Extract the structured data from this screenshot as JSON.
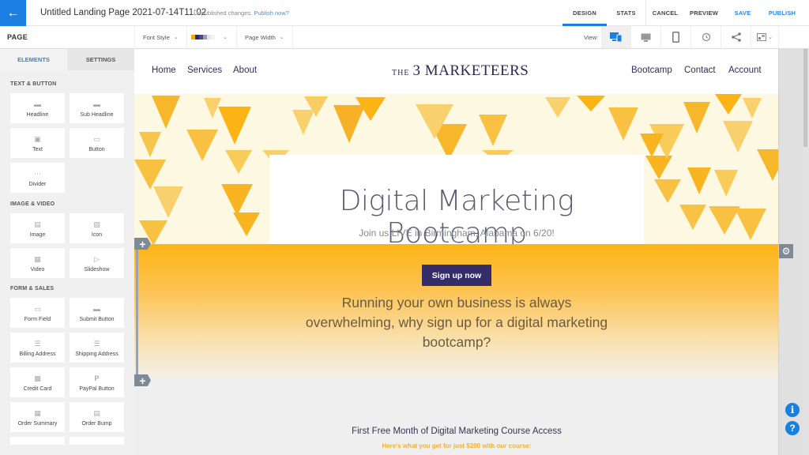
{
  "topbar": {
    "back_icon": "arrow-left-icon",
    "title": "Untitled Landing Page 2021-07-14T11:02",
    "unpublished_text": "Unpublished changes.",
    "publish_link": "Publish now?",
    "tabs": {
      "design": "DESIGN",
      "stats": "STATS",
      "cancel": "CANCEL",
      "preview": "PREVIEW",
      "save": "SAVE",
      "publish": "PUBLISH"
    },
    "accent_color": "#1a7fe0"
  },
  "toolbar": {
    "page_label": "PAGE",
    "font_style": "Font Style",
    "palette_colors": [
      "#f6a800",
      "#2d2a6a",
      "#4b4a7e",
      "#9c9cb0",
      "#e4e4ea",
      "#f4f4f6"
    ],
    "page_width": "Page Width",
    "view_label": "View:",
    "view_buttons": [
      "responsive-view-icon",
      "desktop-icon",
      "mobile-icon",
      "history-icon",
      "share-icon",
      "image-settings-icon"
    ]
  },
  "sidebar": {
    "tabs": {
      "elements": "ELEMENTS",
      "settings": "SETTINGS"
    },
    "sections": [
      {
        "title": "TEXT & BUTTON",
        "items": [
          "Headline",
          "Sub Headline",
          "Text",
          "Button",
          "Divider"
        ]
      },
      {
        "title": "IMAGE & VIDEO",
        "items": [
          "Image",
          "Icon",
          "Video",
          "Slideshow"
        ]
      },
      {
        "title": "FORM & SALES",
        "items": [
          "Form Field",
          "Submit Button",
          "Billing Address",
          "Shipping Address",
          "Credit Card",
          "PayPal Button",
          "Order Summary",
          "Order Bump"
        ]
      }
    ]
  },
  "page": {
    "nav_left": [
      "Home",
      "Services",
      "About"
    ],
    "logo_small": "THE",
    "logo_main": "3 MARKETEERS",
    "nav_right": [
      "Bootcamp",
      "Contact",
      "Account"
    ],
    "hero_title": "Digital Marketing Bootcamp",
    "hero_subtitle": "Join us LIVE in Birmingham, Alabama on 6/20!",
    "signup_button": "Sign up now",
    "band_text": "Running your own business is always overwhelming, why sign up for a digital marketing bootcamp?",
    "section_title": "First Free Month of Digital Marketing Course Access",
    "section_subtitle": "Here's what you get for just $200 with our course:",
    "button_color": "#352d6a",
    "brand_yellow": "#fdb416"
  },
  "controls": {
    "add_section_icon": "+",
    "settings_icon": "⚙",
    "info_icon": "i",
    "help_icon": "?"
  }
}
